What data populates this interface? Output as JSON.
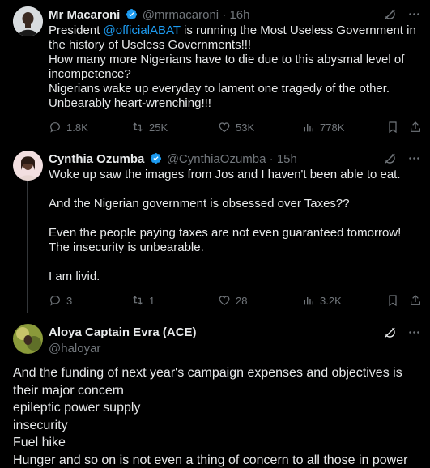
{
  "tweets": [
    {
      "name": "Mr Macaroni",
      "handle": "@mrmacaroni",
      "sep": "·",
      "time": "16h",
      "verified": true,
      "body_pre": "President ",
      "mention": "@officialABAT",
      "body_post": " is running the Most Useless Government in the history of Useless Governments!!!",
      "lines": [
        "How many more Nigerians have to die due to this abysmal level of incompetence?",
        "Nigerians wake up everyday to lament one tragedy of the other. Unbearably heart-wrenching!!!"
      ],
      "replies": "1.8K",
      "retweets": "25K",
      "likes": "53K",
      "views": "778K"
    },
    {
      "name": "Cynthia Ozumba",
      "handle": "@CynthiaOzumba",
      "sep": "·",
      "time": "15h",
      "verified": true,
      "paragraphs": [
        "Woke up saw the images from Jos and I haven't been able to eat.",
        "And the Nigerian government is obsessed over Taxes??",
        "Even the people paying taxes are not even guaranteed tomorrow! The insecurity is unbearable.",
        "I am livid."
      ],
      "replies": "3",
      "retweets": "1",
      "likes": "28",
      "views": "3.2K"
    },
    {
      "name": "Aloya Captain Evra (ACE)",
      "handle": "@haloyar",
      "lines": [
        "And the funding of next year's campaign expenses and objectives is their major concern",
        "epileptic power supply",
        "insecurity",
        "Fuel hike",
        "Hunger and so on is not even a thing of concern to all those in power"
      ]
    }
  ],
  "colors": {
    "background": "#000000",
    "text": "#e7e9ea",
    "muted": "#71767b",
    "accent": "#1d9bf0",
    "verified": "#1d9bf0"
  },
  "icons": [
    "grok-icon",
    "more-icon",
    "reply-icon",
    "retweet-icon",
    "like-icon",
    "views-icon",
    "bookmark-icon",
    "share-icon",
    "verified-badge-icon"
  ]
}
